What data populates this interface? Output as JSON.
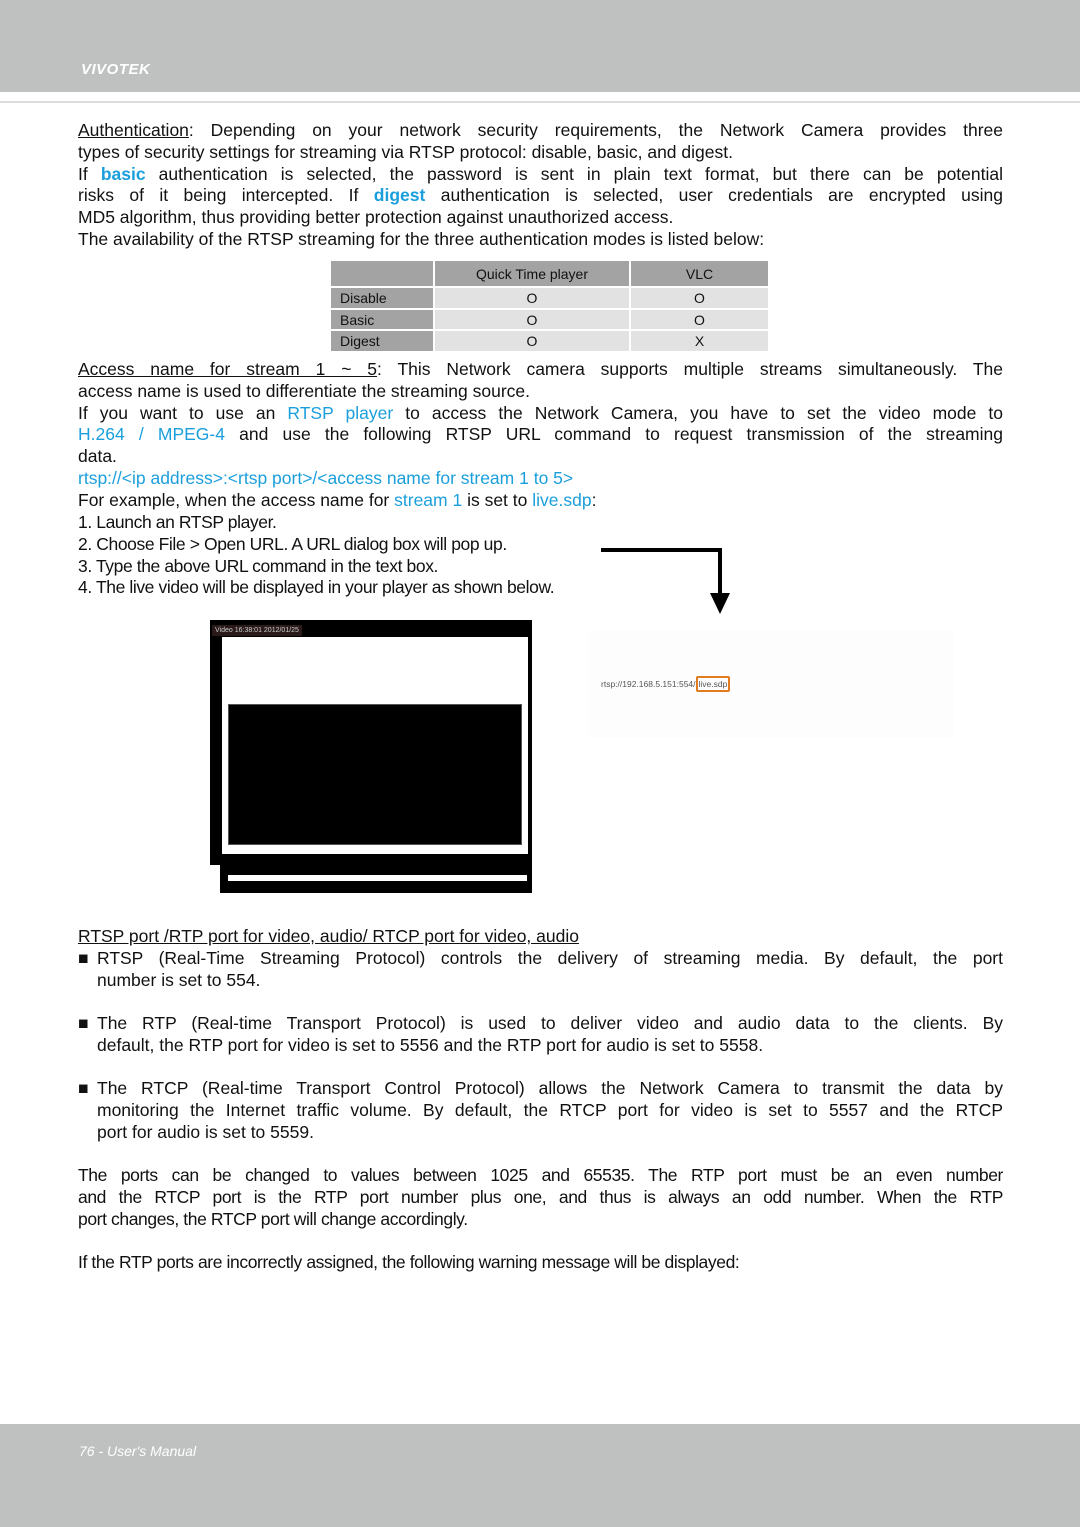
{
  "header": {
    "brand": "VIVOTEK"
  },
  "auth_section": {
    "title": "Authentication",
    "lines": [
      ": Depending on your network security requirements, the Network Camera provides three",
      "types of security settings for streaming via RTSP protocol: disable, basic, and digest."
    ],
    "basic_pre": "If ",
    "basic_word": "basic",
    "basic_post": " authentication is selected, the password is sent in plain text format, but there can be potential",
    "digest_pre": "risks of it being intercepted. If ",
    "digest_word": "digest",
    "digest_post": " authentication is selected, user credentials are encrypted using",
    "md5_line": "MD5 algorithm, thus providing better protection against unauthorized access.",
    "availability_line": "The availability of the RTSP streaming for the three authentication modes is listed below:"
  },
  "auth_table": {
    "columns": [
      "",
      "Quick Time player",
      "VLC"
    ],
    "rows": [
      {
        "mode": "Disable",
        "quicktime": "O",
        "vlc": "O"
      },
      {
        "mode": "Basic",
        "quicktime": "O",
        "vlc": "O"
      },
      {
        "mode": "Digest",
        "quicktime": "O",
        "vlc": "X"
      }
    ]
  },
  "access_section": {
    "title": "Access name for stream 1 ~ 5",
    "line1_post": ": This Network camera supports multiple streams simultaneously. The",
    "line2": "access name is used to differentiate the streaming source.",
    "line3_pre": "If you want to use an ",
    "line3_link": "RTSP player",
    "line3_post": " to access the Network Camera, you have to set the video mode to",
    "line4_link": "H.264 / MPEG-4",
    "line4_post": " and use the following RTSP URL command to request transmission of the streaming",
    "line5": "data.",
    "url_template": "rtsp://<ip address>:<rtsp port>/<access name for stream 1 to 5>",
    "example_pre": "For example, when the access name for ",
    "example_stream": "stream 1",
    "example_mid": " is set to ",
    "example_value": "live.sdp",
    "example_post": ":",
    "steps": [
      "1. Launch an RTSP player.",
      "2. Choose File > Open URL. A URL dialog box will pop up.",
      "3. Type the above URL command in the text box.",
      "4. The live video will be displayed in your player as shown below."
    ]
  },
  "player_figure": {
    "caption": "Video 16:38:01 2012/01/25"
  },
  "url_dialog": {
    "url_prefix": "rtsp://192.168.5.151:554/",
    "url_highlight": "live.sdp",
    "highlight_color": "#e07b1e"
  },
  "ports_section": {
    "title": "RTSP port /RTP port for video, audio/ RTCP port for video, audio",
    "bullet_glyph": "■",
    "bullets": [
      {
        "line1": "RTSP (Real-Time Streaming Protocol) controls the delivery of streaming media. By default, the port",
        "line2": "number is set to 554."
      },
      {
        "line1": "The RTP (Real-time Transport Protocol) is used to deliver video and audio data to the clients. By",
        "line2": "default, the RTP port for video is set to 5556 and the RTP port for audio is set to 5558."
      },
      {
        "line1": "The RTCP (Real-time Transport Control Protocol) allows the Network Camera to transmit the data by",
        "line2": "monitoring the Internet traffic volume. By default, the RTCP port for video is set to 5557 and the RTCP",
        "line3": "port for audio is set to 5559."
      }
    ],
    "range_para": [
      "The ports can be changed to values between 1025 and 65535. The RTP port must be an even number",
      "and the RTCP port is the RTP port number plus one, and thus is always an odd number. When the RTP",
      "port changes, the RTCP port will change accordingly."
    ],
    "warning_line": "If the RTP ports are incorrectly assigned, the following warning message will be displayed:"
  },
  "colors": {
    "link_blue": "#1a9fdc",
    "band_gray": "#bfc1c0",
    "table_dark": "#a3a3a3",
    "table_light": "#e2e2e2"
  },
  "footer": {
    "page_label": "76 - User's Manual"
  }
}
